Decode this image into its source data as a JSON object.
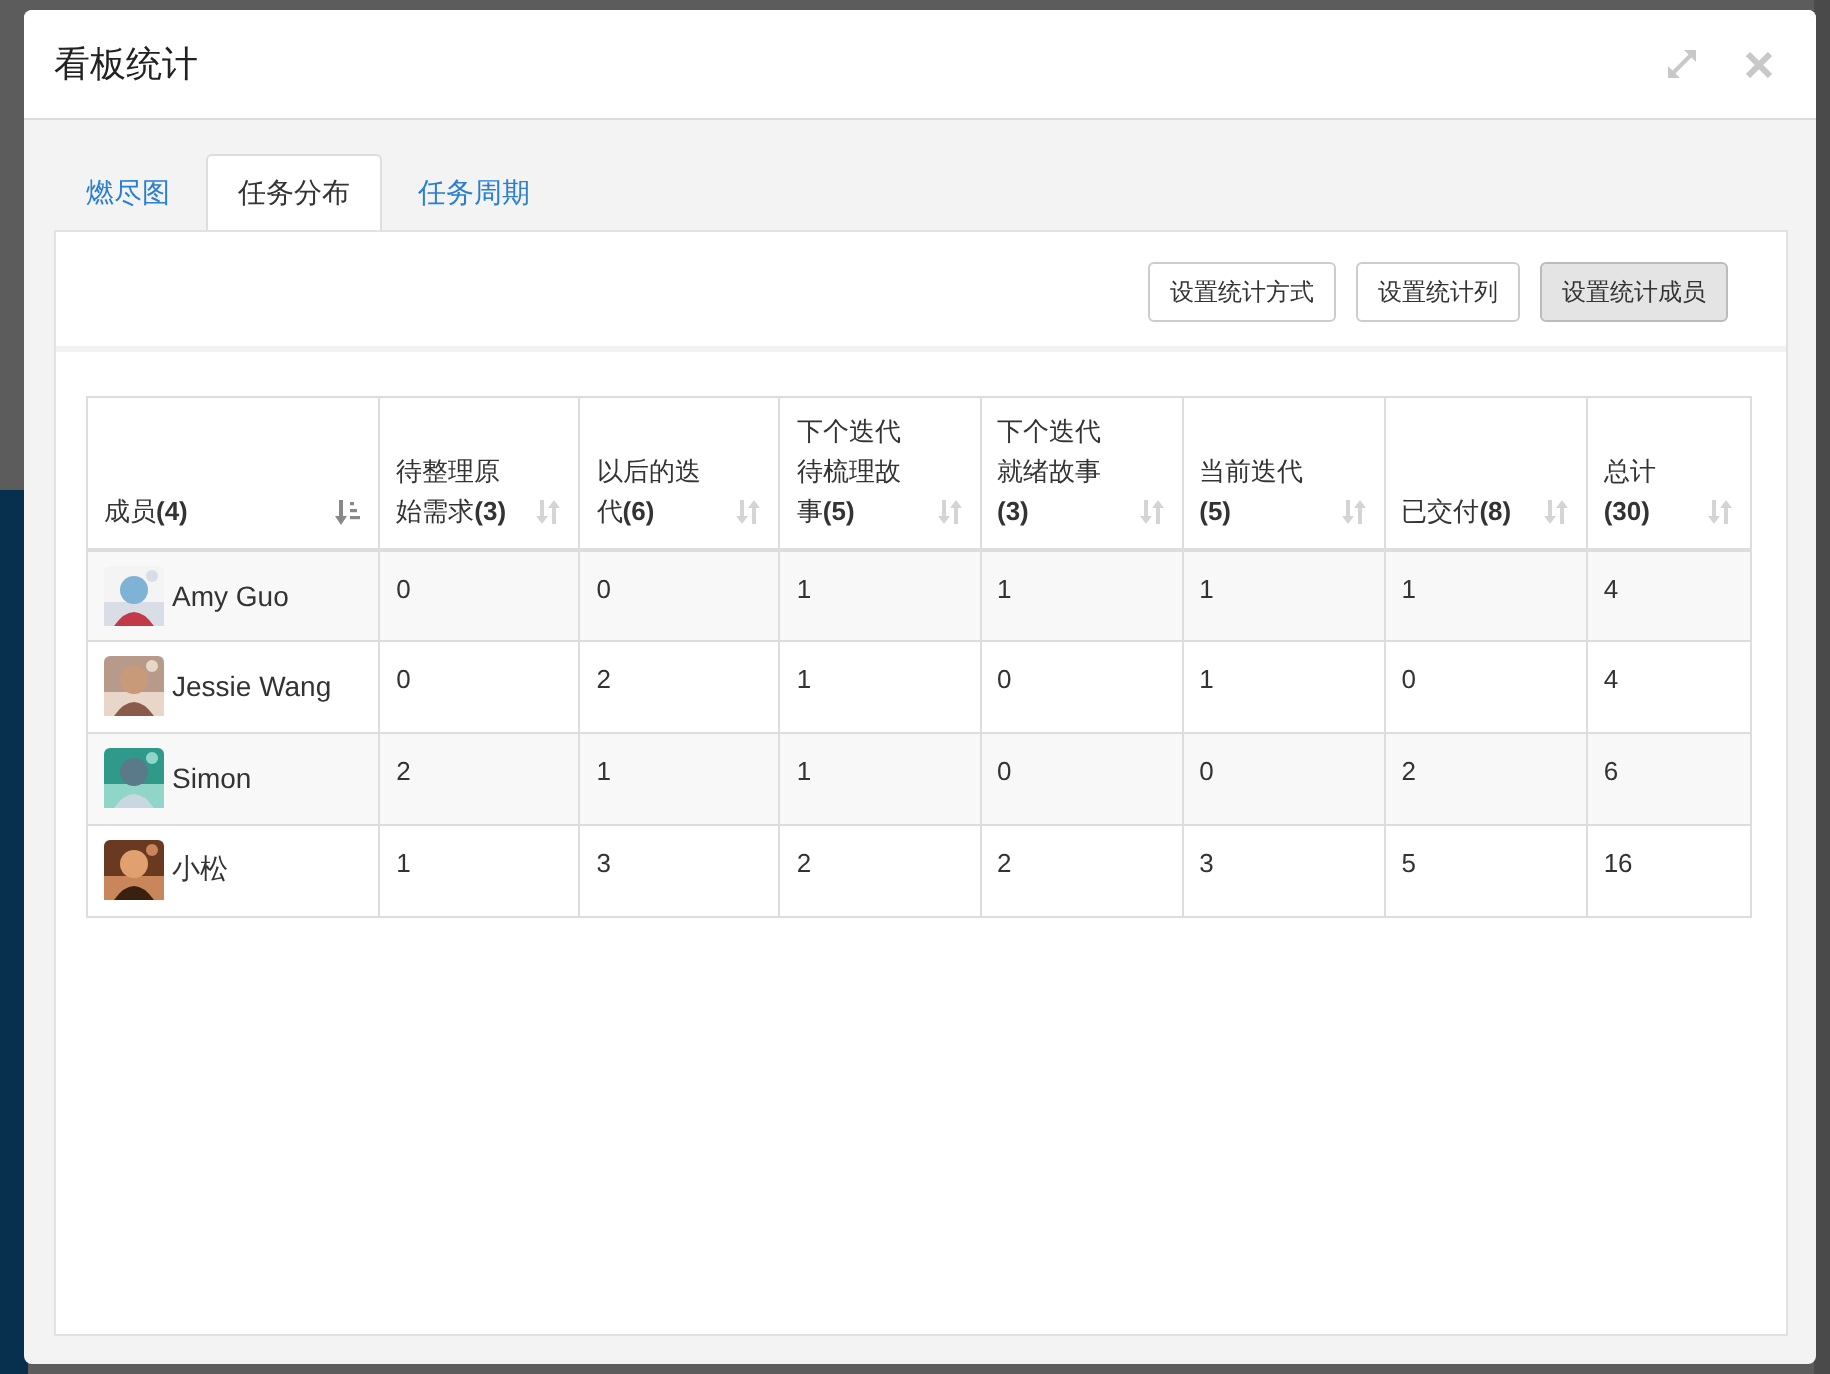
{
  "dialog": {
    "title": "看板统计"
  },
  "tabs": [
    {
      "label": "燃尽图",
      "selected": false
    },
    {
      "label": "任务分布",
      "selected": true
    },
    {
      "label": "任务周期",
      "selected": false
    }
  ],
  "toolbar": [
    {
      "label": "设置统计方式",
      "selected": false
    },
    {
      "label": "设置统计列",
      "selected": false
    },
    {
      "label": "设置统计成员",
      "selected": true
    }
  ],
  "table": {
    "columns": [
      {
        "label": "成员**(4)**",
        "sorted": true
      },
      {
        "label": "待整理原始需求**(3)**",
        "sorted": false
      },
      {
        "label": "以后的迭代**(6)**",
        "sorted": false
      },
      {
        "label": "下个迭代待梳理故事**(5)**",
        "sorted": false
      },
      {
        "label": "下个迭代就绪故事**(3)**",
        "sorted": false
      },
      {
        "label": "当前迭代**(5)**",
        "sorted": false
      },
      {
        "label": "已交付**(8)**",
        "sorted": false
      },
      {
        "label": "总计**(30)**",
        "sorted": false
      }
    ],
    "rows": [
      {
        "cells": [
          "Amy Guo",
          "0",
          "0",
          "1",
          "1",
          "1",
          "1",
          "4"
        ]
      },
      {
        "cells": [
          "Jessie Wang",
          "0",
          "2",
          "1",
          "0",
          "1",
          "0",
          "4"
        ]
      },
      {
        "cells": [
          "Simon",
          "2",
          "1",
          "1",
          "0",
          "0",
          "2",
          "6"
        ]
      },
      {
        "cells": [
          "小松",
          "1",
          "3",
          "2",
          "2",
          "3",
          "5",
          "16"
        ]
      }
    ]
  }
}
